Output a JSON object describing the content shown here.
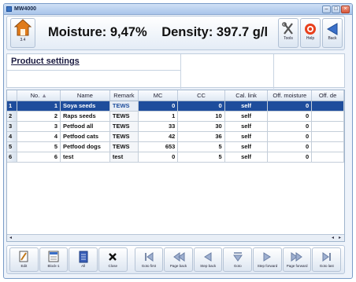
{
  "window": {
    "title": "MW4000"
  },
  "header": {
    "home_label": "3.4",
    "moisture_text": "Moisture: 9,47%",
    "density_text": "Density: 397.7 g/l",
    "buttons": [
      {
        "icon": "tools-icon",
        "label": "Tools"
      },
      {
        "icon": "help-icon",
        "label": "Help"
      },
      {
        "icon": "back-icon",
        "label": "Back"
      }
    ]
  },
  "section": {
    "title": "Product settings"
  },
  "table": {
    "columns": [
      "",
      "No.",
      "Name",
      "Remark",
      "MC",
      "CC",
      "Cal. link",
      "Off. moisture",
      "Off. de"
    ],
    "rows": [
      {
        "row": "1",
        "no": "1",
        "name": "Soya seeds",
        "remark": "TEWS",
        "mc": "0",
        "cc": "0",
        "cal": "self",
        "offm": "0"
      },
      {
        "row": "2",
        "no": "2",
        "name": "Raps seeds",
        "remark": "TEWS",
        "mc": "1",
        "cc": "10",
        "cal": "self",
        "offm": "0"
      },
      {
        "row": "3",
        "no": "3",
        "name": "Petfood all",
        "remark": "TEWS",
        "mc": "33",
        "cc": "30",
        "cal": "self",
        "offm": "0"
      },
      {
        "row": "4",
        "no": "4",
        "name": "Petfood cats",
        "remark": "TEWS",
        "mc": "42",
        "cc": "36",
        "cal": "self",
        "offm": "0"
      },
      {
        "row": "5",
        "no": "5",
        "name": "Petfood dogs",
        "remark": "TEWS",
        "mc": "653",
        "cc": "5",
        "cal": "self",
        "offm": "0"
      },
      {
        "row": "6",
        "no": "6",
        "name": "test",
        "remark": "test",
        "mc": "0",
        "cc": "5",
        "cal": "self",
        "offm": "0"
      }
    ],
    "selected_row": 1
  },
  "toolbar": {
    "buttons": [
      {
        "icon": "edit-icon",
        "label": "Edit"
      },
      {
        "icon": "block-icon",
        "label": "Block-1"
      },
      {
        "icon": "all-icon",
        "label": "All"
      },
      {
        "icon": "close-icon",
        "label": "Close"
      },
      {
        "icon": "goto-first-icon",
        "label": "Goto first"
      },
      {
        "icon": "page-back-icon",
        "label": "Page back"
      },
      {
        "icon": "step-back-icon",
        "label": "Step back"
      },
      {
        "icon": "goto-icon",
        "label": "Goto"
      },
      {
        "icon": "step-forward-icon",
        "label": "Step forward"
      },
      {
        "icon": "page-forward-icon",
        "label": "Page forward"
      },
      {
        "icon": "goto-last-icon",
        "label": "Goto last"
      }
    ]
  },
  "colors": {
    "selection": "#1e4d9c",
    "accent": "#3a74c4"
  }
}
